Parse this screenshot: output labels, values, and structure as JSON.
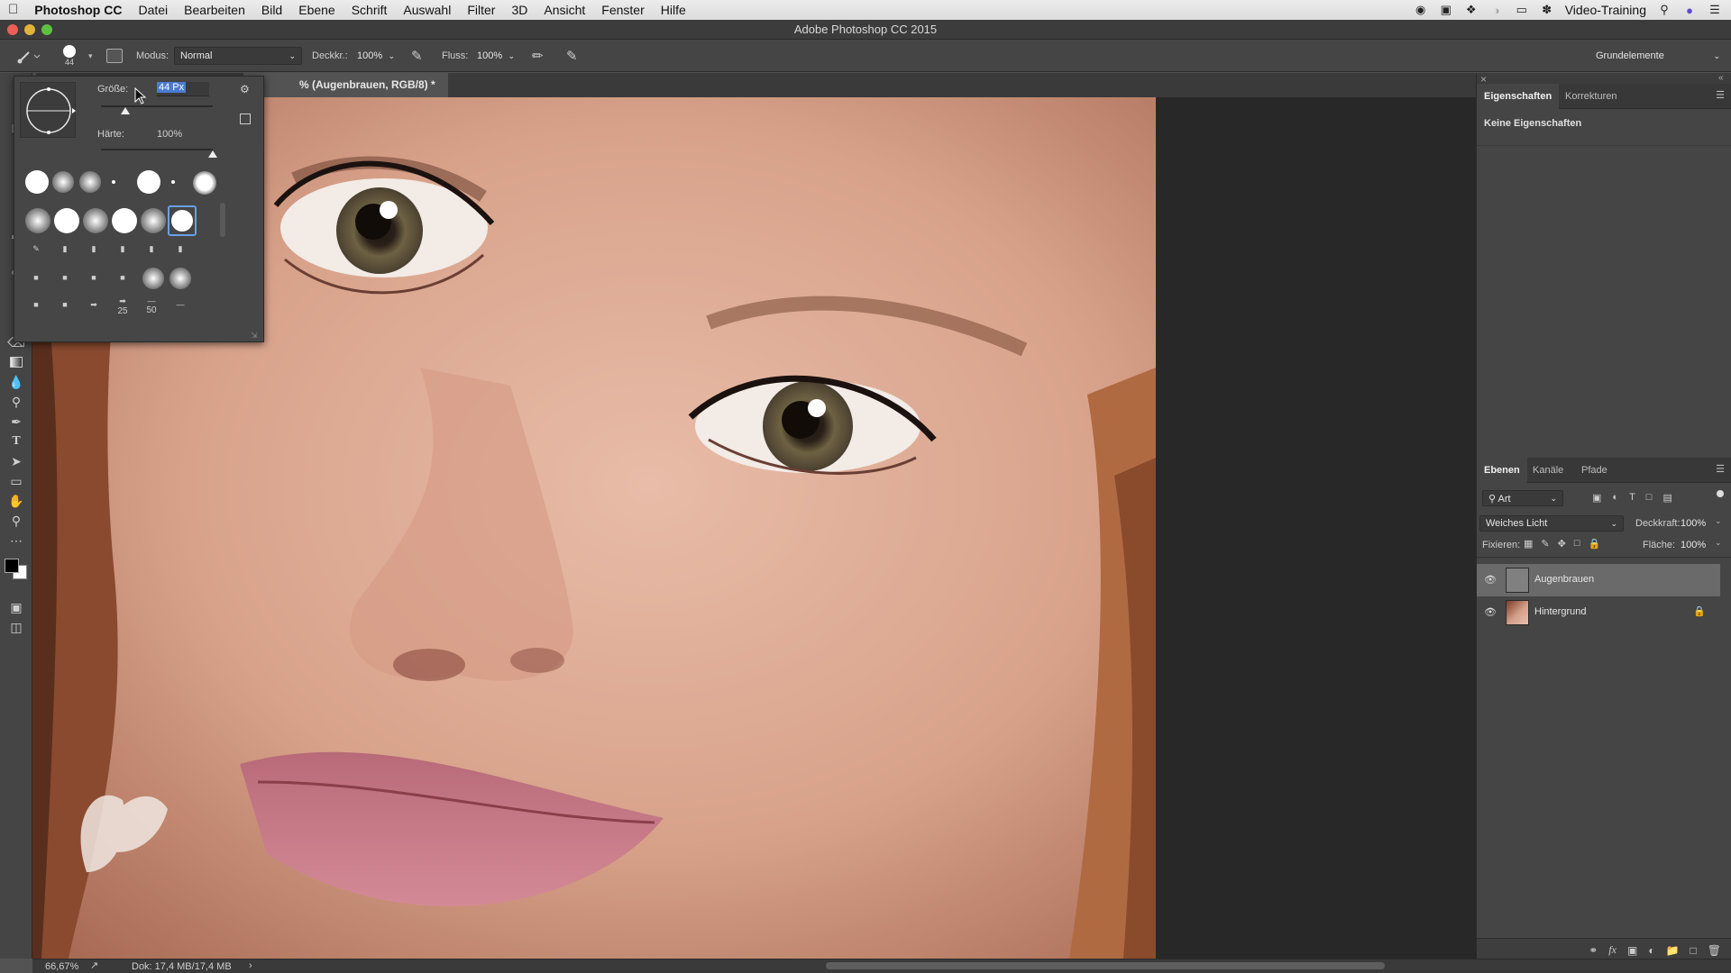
{
  "menubar": {
    "apple": "",
    "app_name": "Photoshop CC",
    "items": [
      "Datei",
      "Bearbeiten",
      "Bild",
      "Ebene",
      "Schrift",
      "Auswahl",
      "Filter",
      "3D",
      "Ansicht",
      "Fenster",
      "Hilfe"
    ],
    "right_label": "Video-Training"
  },
  "window": {
    "title": "Adobe Photoshop CC 2015"
  },
  "options": {
    "brush_size": "44",
    "mode_label": "Modus:",
    "mode_value": "Normal",
    "opacity_label": "Deckkr.:",
    "opacity_value": "100%",
    "flow_label": "Fluss:",
    "flow_value": "100%",
    "workspace": "Grundelemente"
  },
  "document_tab": {
    "title": "% (Augenbrauen, RGB/8) *"
  },
  "brush_popup": {
    "size_label": "Größe:",
    "size_value": "44 Px",
    "hardness_label": "Härte:",
    "hardness_value": "100%",
    "size_fraction": 0.22,
    "hardness_fraction": 1.0,
    "preset_numbers": [
      "25",
      "50"
    ]
  },
  "properties_panel": {
    "tabs": [
      "Eigenschaften",
      "Korrekturen"
    ],
    "empty_text": "Keine Eigenschaften"
  },
  "layers_panel": {
    "tabs": [
      "Ebenen",
      "Kanäle",
      "Pfade"
    ],
    "filter_label": "Art",
    "blend_mode": "Weiches Licht",
    "opacity_label": "Deckkraft:",
    "opacity_value": "100%",
    "lock_label": "Fixieren:",
    "fill_label": "Fläche:",
    "fill_value": "100%",
    "layers": [
      {
        "name": "Augenbrauen",
        "selected": true,
        "locked": false
      },
      {
        "name": "Hintergrund",
        "selected": false,
        "locked": true
      }
    ]
  },
  "statusbar": {
    "zoom": "66,67%",
    "doc_info": "Dok: 17,4 MB/17,4 MB"
  },
  "colors": {
    "foreground": "#000000",
    "background": "#ffffff",
    "selection_blue": "#4a7bd1"
  }
}
